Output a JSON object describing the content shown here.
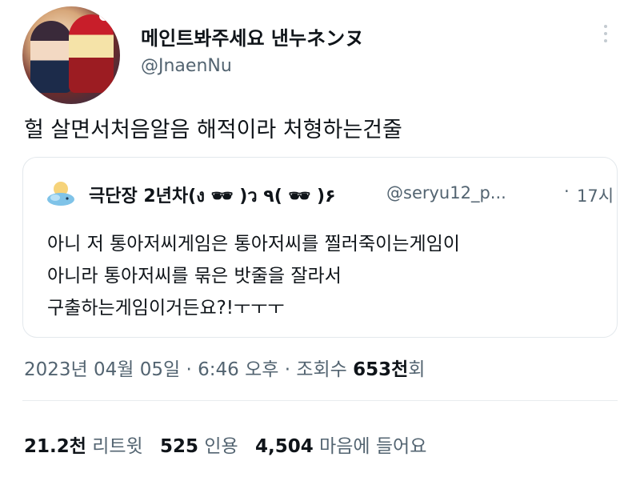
{
  "tweet": {
    "display_name": "메인트봐주세요 낸누ネンヌ",
    "handle": "@JnaenNu",
    "text": "헐 살면서처음알음 해적이라 처형하는건줄"
  },
  "quoted": {
    "display_name": "극단장 2년차(ง 🕶 )ว ٩( 🕶 )۶",
    "handle": "@seryu12_p...",
    "dot": "·",
    "time": "17시",
    "lines": [
      "아니 저 통아저씨게임은 통아저씨를 찔러죽이는게임이",
      "아니라 통아저씨를 묶은 밧줄을 잘라서",
      "구출하는게임이거든요?!ㅜㅜㅜ"
    ]
  },
  "meta": {
    "date": "2023년 04월 05일",
    "sep1": " · ",
    "time": "6:46 오후",
    "sep2": " · ",
    "views_label": "조회수 ",
    "views_count": "653천",
    "views_suffix": "회"
  },
  "stats": {
    "retweets_count": "21.2천",
    "retweets_label": "리트윗",
    "quotes_count": "525",
    "quotes_label": "인용",
    "likes_count": "4,504",
    "likes_label": "마음에 들어요"
  },
  "colors": {
    "text": "#0f1419",
    "secondary": "#536471",
    "border": "#e3e8ec"
  },
  "icons": {
    "more": "more-vertical-icon",
    "quoted_avatar": "whale-cloud-icon"
  }
}
